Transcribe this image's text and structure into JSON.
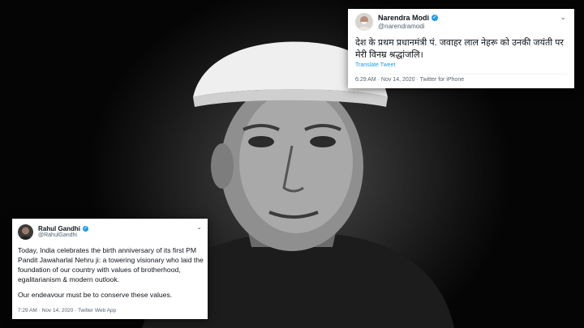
{
  "tweets": {
    "modi": {
      "display_name": "Narendra Modi",
      "handle": "@narendramodi",
      "text": "देश के प्रथम प्रधानमंत्री पं. जवाहर लाल नेहरू को उनकी जयंती पर मेरी विनम्र श्रद्धांजलि।",
      "translate_label": "Translate Tweet",
      "timestamp": "6:29 AM · Nov 14, 2020 · Twitter for iPhone"
    },
    "rahul": {
      "display_name": "Rahul Gandhi",
      "handle": "@RahulGandhi",
      "paragraphs": [
        "Today, India celebrates the birth anniversary of its first PM Pandit Jawaharlal Nehru ji: a towering visionary who laid the foundation of our country with values of brotherhood, egalitarianism & modern outlook.",
        "Our endeavour must be to conserve these values."
      ],
      "timestamp": "7:29 AM · Nov 14, 2020 · Twitter Web App"
    }
  },
  "icons": {
    "verified": "verified-badge-icon",
    "more": "chevron-down-icon"
  },
  "colors": {
    "verified": "#1d9bf0",
    "link": "#1d9bf0",
    "secondary_text": "#536471"
  }
}
